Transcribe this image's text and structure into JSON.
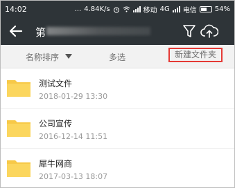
{
  "status_bar": {
    "time": "14:02",
    "dots": "...",
    "speed": "4.84K/s",
    "carrier1_suffix": "移动",
    "network": "4G",
    "carrier2": "电信",
    "battery": "54%"
  },
  "header": {
    "title_visible_char": "第",
    "icons": [
      "back-arrow-icon",
      "filter-icon",
      "cloud-upload-icon"
    ]
  },
  "toolbar": {
    "sort_label": "名称排序",
    "multi_select_label": "多选",
    "new_folder_label": "新建文件夹",
    "highlight_color": "#e53935"
  },
  "files": [
    {
      "name": "测试文件",
      "date": "2018-01-29 13:30"
    },
    {
      "name": "公司宣传",
      "date": "2016-12-14 11:51"
    },
    {
      "name": "犀牛网商",
      "date": "2017-03-13 18:07"
    }
  ],
  "colors": {
    "header_bg": "#2e3438",
    "folder_yellow": "#f7c948"
  }
}
